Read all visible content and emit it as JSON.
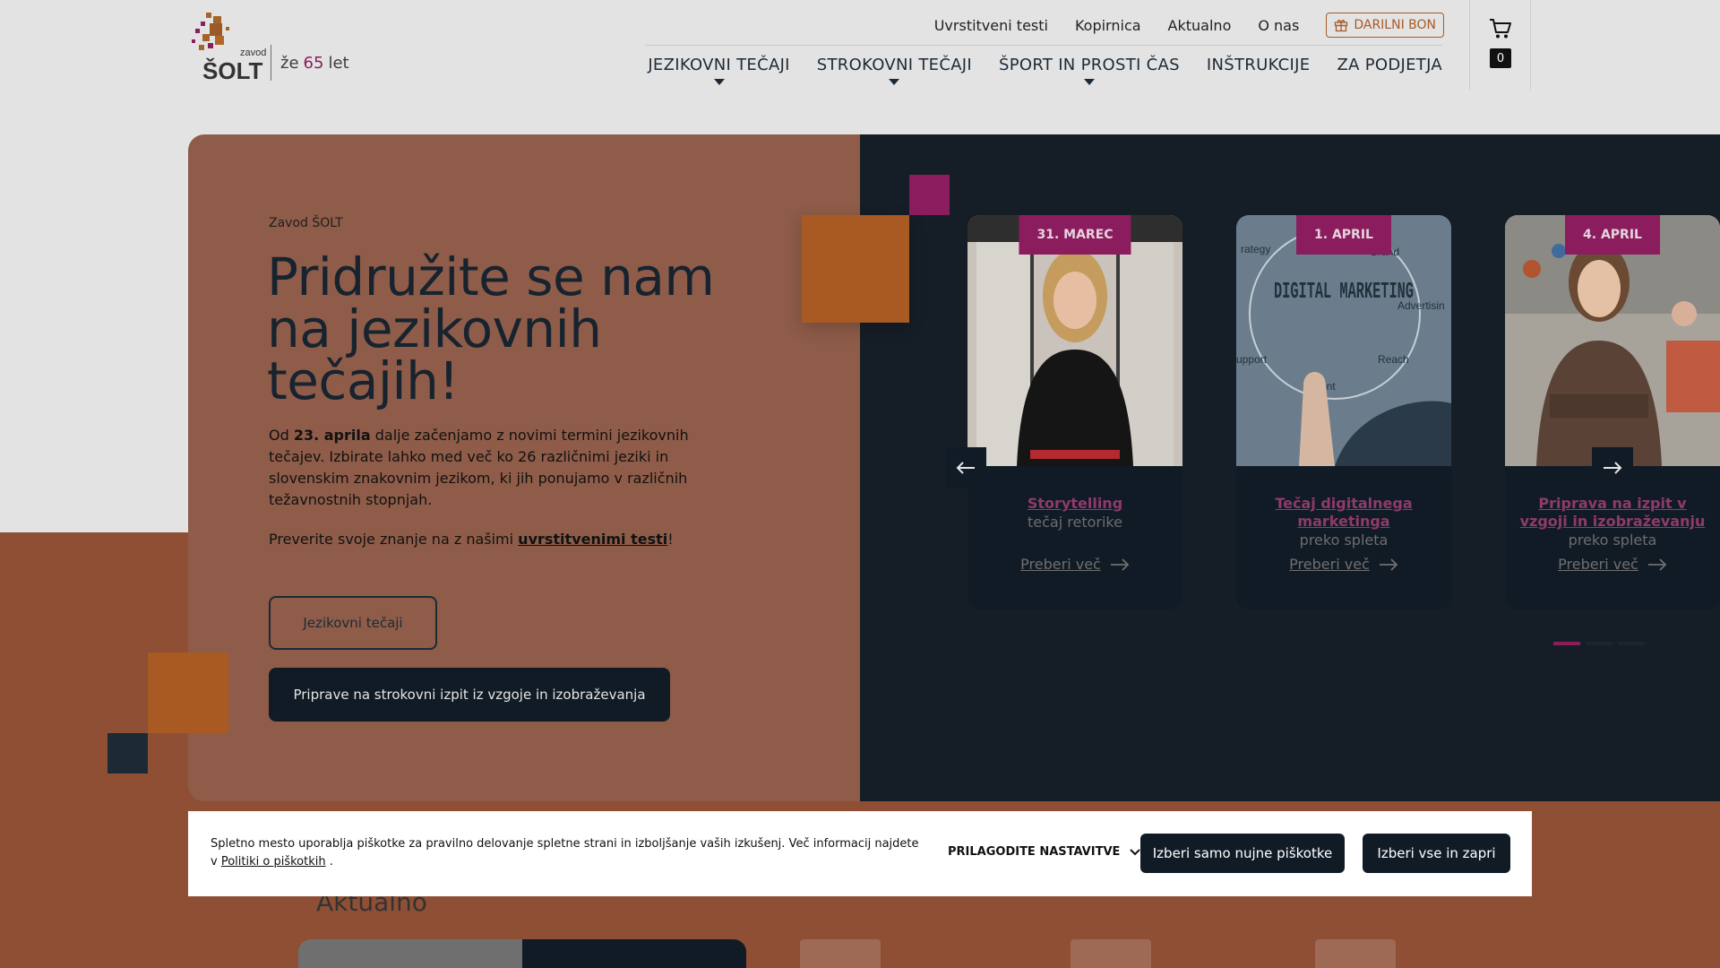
{
  "brand": {
    "logo_text": "zavod ŠOLT",
    "tagline_prefix": "že",
    "tagline_number": "65",
    "tagline_suffix": "let"
  },
  "top_links": [
    "Uvrstitveni testi",
    "Kopirnica",
    "Aktualno",
    "O nas"
  ],
  "gift_label": "DARILNI BON",
  "main_nav": [
    {
      "label": "JEZIKOVNI TEČAJI",
      "has_dropdown": true
    },
    {
      "label": "STROKOVNI TEČAJI",
      "has_dropdown": true
    },
    {
      "label": "ŠPORT IN PROSTI ČAS",
      "has_dropdown": true
    },
    {
      "label": "INŠTRUKCIJE",
      "has_dropdown": false
    },
    {
      "label": "ZA PODJETJA",
      "has_dropdown": false
    }
  ],
  "cart": {
    "count": "0",
    "icon": "cart-icon"
  },
  "hero": {
    "eyebrow": "Zavod ŠOLT",
    "title": "Pridružite se nam na jezikovnih tečajih!",
    "p_before": "Od ",
    "p_bold": "23. aprila",
    "p_after": " dalje začenjamo z novimi termini jezikovnih tečajev. Izbirate lahko med več ko 26 različnimi jeziki in slovenskim znakovnim jezikom, ki jih ponujamo v različnih težavnostnih stopnjah.",
    "p2_before": "Preverite svoje znanje na z našimi ",
    "p2_link": "uvrstitvenimi testi",
    "p2_after": "!",
    "btn_primary": "Jezikovni tečaji",
    "btn_secondary": "Priprave na strokovni izpit iz vzgoje in izobraževanja"
  },
  "carousel": {
    "cards": [
      {
        "date": "31. MAREC",
        "title": "Storytelling",
        "subtitle": "tečaj retorike",
        "more": "Preberi več"
      },
      {
        "date": "1. APRIL",
        "title": "Tečaj digitalnega marketinga",
        "subtitle": "preko spleta",
        "more": "Preberi več",
        "image_text": "DIGITAL MARKETING"
      },
      {
        "date": "4. APRIL",
        "title": "Priprava na izpit v vzgoji in izobraževanju",
        "subtitle": "preko spleta",
        "more": "Preberi več"
      }
    ],
    "active_slide": 1,
    "slide_count": 3
  },
  "section_title": "Aktualno",
  "cookie": {
    "text": "Spletno mesto uporablja piškotke za pravilno delovanje spletne strani in izboljšanje vaših izkušenj. Več informacij najdete v ",
    "link": "Politiki o piškotkih",
    "text_end": " .",
    "customize": "PRILAGODITE NASTAVITVE",
    "btn_necessary": "Izberi samo nujne piškotke",
    "btn_all": "Izberi vse in zapri"
  },
  "colors": {
    "brand_magenta": "#8b1d5f",
    "brand_orange": "#a65a27",
    "dark_navy": "#111b26"
  }
}
